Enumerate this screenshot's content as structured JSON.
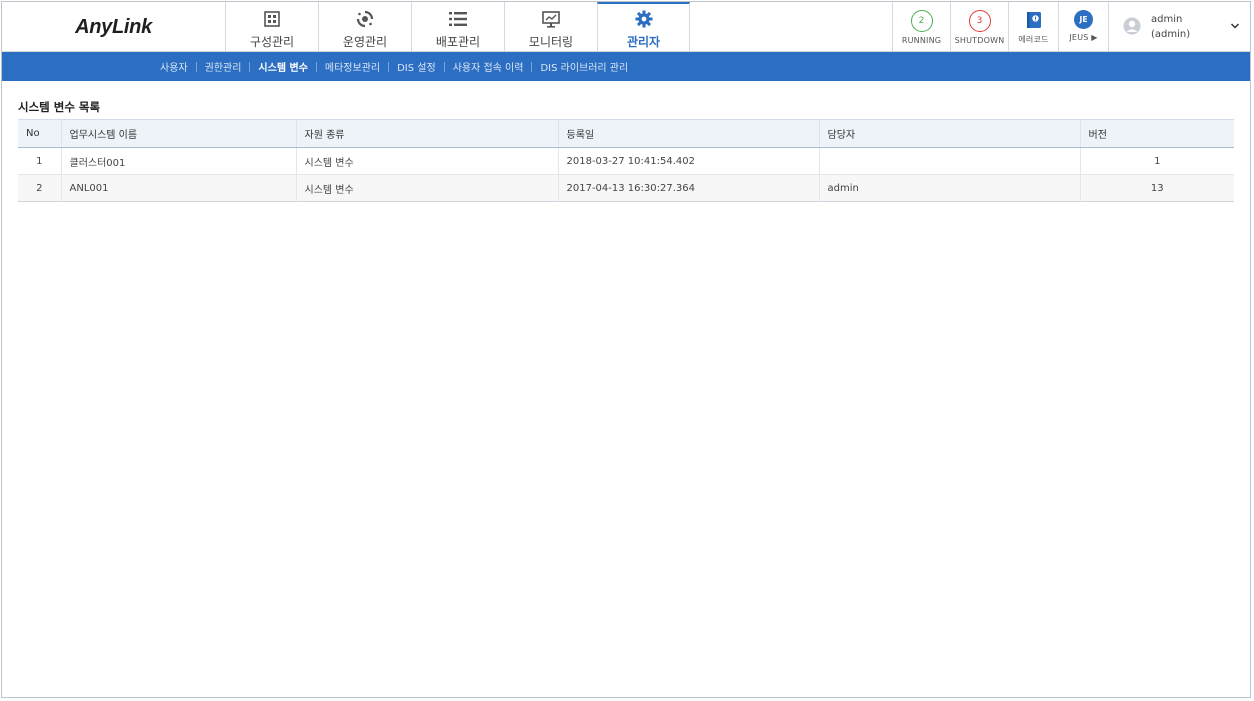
{
  "header": {
    "logo": "AnyLink",
    "tabs": [
      {
        "label": "구성관리",
        "icon": "grid-icon"
      },
      {
        "label": "운영관리",
        "icon": "operation-icon"
      },
      {
        "label": "배포관리",
        "icon": "list-icon"
      },
      {
        "label": "모니터링",
        "icon": "monitor-icon"
      },
      {
        "label": "관리자",
        "icon": "gear-icon",
        "active": true
      }
    ],
    "status": {
      "running_count": "2",
      "running_label": "RUNNING",
      "shutdown_count": "3",
      "shutdown_label": "SHUTDOWN",
      "error_label": "에러코드",
      "jeus_badge": "JE",
      "jeus_label": "JEUS ▶"
    },
    "user": {
      "name": "admin",
      "role": "(admin)"
    }
  },
  "subnav": {
    "items": [
      "사용자",
      "권한관리",
      "시스템 변수",
      "메타정보관리",
      "DIS 설정",
      "사용자 접속 이력",
      "DIS 라이브러리 관리"
    ],
    "active_index": 2
  },
  "main": {
    "title": "시스템 변수 목록",
    "columns": [
      "No",
      "업무시스템 이름",
      "자원 종류",
      "등록일",
      "담당자",
      "버전"
    ],
    "rows": [
      {
        "no": "1",
        "name": "클러스터001",
        "type": "시스템 변수",
        "date": "2018-03-27 10:41:54.402",
        "owner": "",
        "version": "1"
      },
      {
        "no": "2",
        "name": "ANL001",
        "type": "시스템 변수",
        "date": "2017-04-13 16:30:27.364",
        "owner": "admin",
        "version": "13"
      }
    ]
  },
  "colors": {
    "accent": "#2b6ec2",
    "running": "#4caf50",
    "shutdown": "#e53935"
  }
}
